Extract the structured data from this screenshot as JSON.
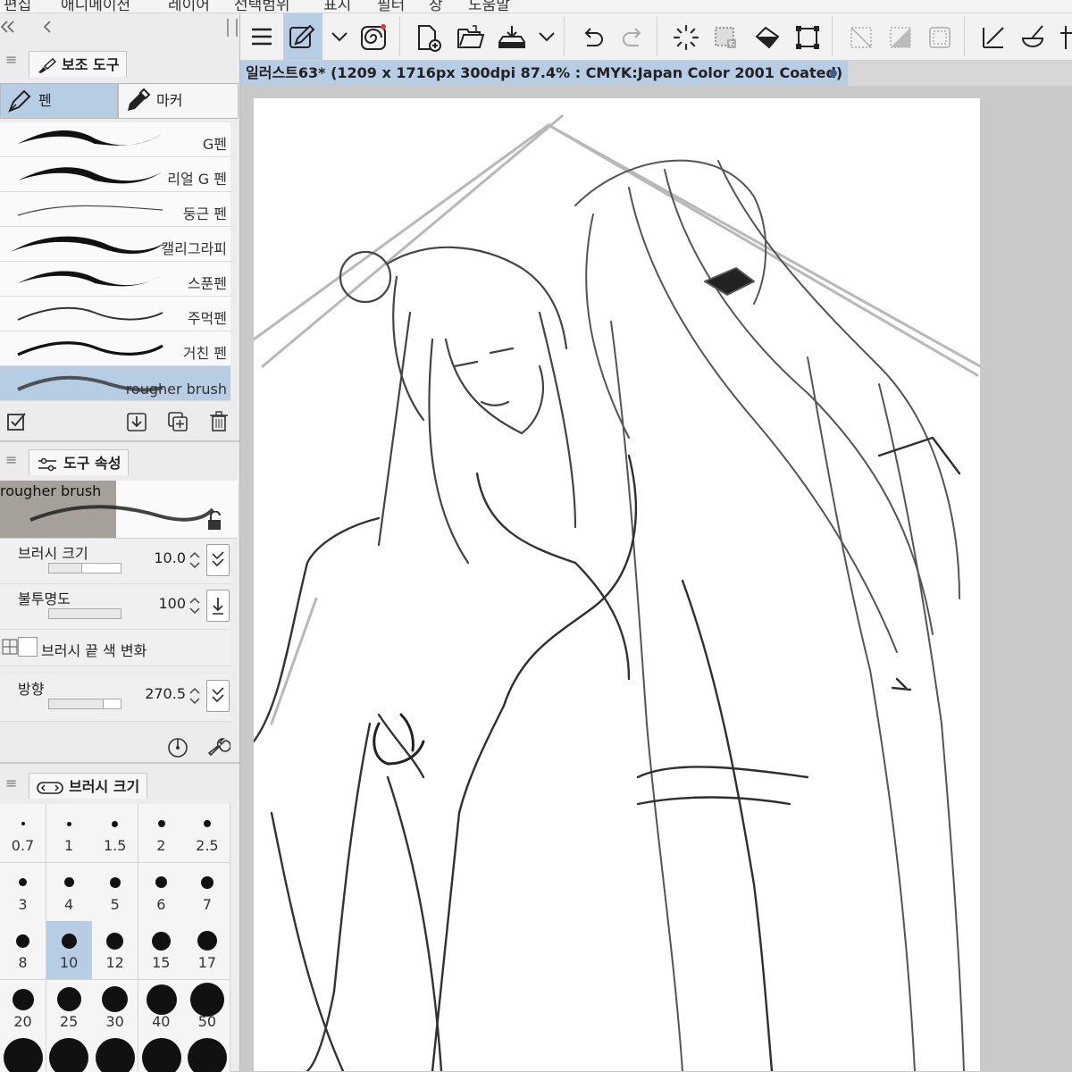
{
  "menu": {
    "items": [
      "편집",
      "애니메이션",
      "레이어",
      "선택범위",
      "표시",
      "필터",
      "창",
      "도움말"
    ]
  },
  "left_panel": {
    "collapse_icon": "double-chevron-left-icon",
    "back_icon": "chevron-left-icon",
    "subtool": {
      "tab_label": "보조 도구",
      "tabs": [
        {
          "label": "펜",
          "icon": "pen-nib-icon",
          "selected": true
        },
        {
          "label": "마커",
          "icon": "marker-icon",
          "selected": false
        }
      ],
      "brushes": [
        {
          "name": "G펜",
          "selected": false
        },
        {
          "name": "리얼 G 펜",
          "selected": false
        },
        {
          "name": "둥근 펜",
          "selected": false
        },
        {
          "name": "캘리그라피",
          "selected": false
        },
        {
          "name": "스푼펜",
          "selected": false
        },
        {
          "name": "주먹펜",
          "selected": false
        },
        {
          "name": "거친 펜",
          "selected": false
        },
        {
          "name": "rougher brush",
          "selected": true
        }
      ],
      "footer_icons": [
        "checkbox-edit-icon",
        "download-icon",
        "duplicate-icon",
        "trash-icon"
      ]
    },
    "tool_property": {
      "tab_label": "도구 속성",
      "brush_name": "rougher brush",
      "lock_icon": "unlock-icon",
      "properties": [
        {
          "label": "브러시 크기",
          "value": "10.0",
          "slider_fraction": 0.1
        },
        {
          "label": "불투명도",
          "value": "100",
          "slider_fraction": 1.0
        },
        {
          "label": "방향",
          "value": "270.5",
          "slider_fraction": 0.75
        }
      ],
      "tip_color_label": "브러시 끝 색 변화",
      "bottom_icons": [
        "dial-icon",
        "wrench-icon"
      ]
    },
    "brush_size": {
      "tab_label": "브러시 크기",
      "sizes": [
        "0.7",
        "1",
        "1.5",
        "2",
        "2.5",
        "3",
        "4",
        "5",
        "6",
        "7",
        "8",
        "10",
        "12",
        "15",
        "17",
        "20",
        "25",
        "30",
        "40",
        "50"
      ],
      "selected": "10"
    }
  },
  "toolbar": {
    "icons": [
      "hamburger-menu-icon",
      "pen-tool-icon",
      "chevron-down-icon",
      "spiral-icon",
      "new-file-icon",
      "open-folder-icon",
      "export-icon",
      "chevron-down-icon",
      "undo-icon",
      "redo-icon",
      "loading-spinner-icon",
      "select-all-icon",
      "fill-icon",
      "transform-icon",
      "deselect-icon",
      "invert-selection-icon",
      "show-selection-icon",
      "ruler-icon",
      "bucket-icon",
      "snap-icon"
    ]
  },
  "document": {
    "title": "일러스트63* (1209 x 1716px 300dpi 87.4% : CMYK:Japan Color 2001 Coated)"
  },
  "colors": {
    "selection": "#b7cde4",
    "panel": "#ececec",
    "canvas": "#ffffff",
    "workspace": "#c9c9c9"
  }
}
